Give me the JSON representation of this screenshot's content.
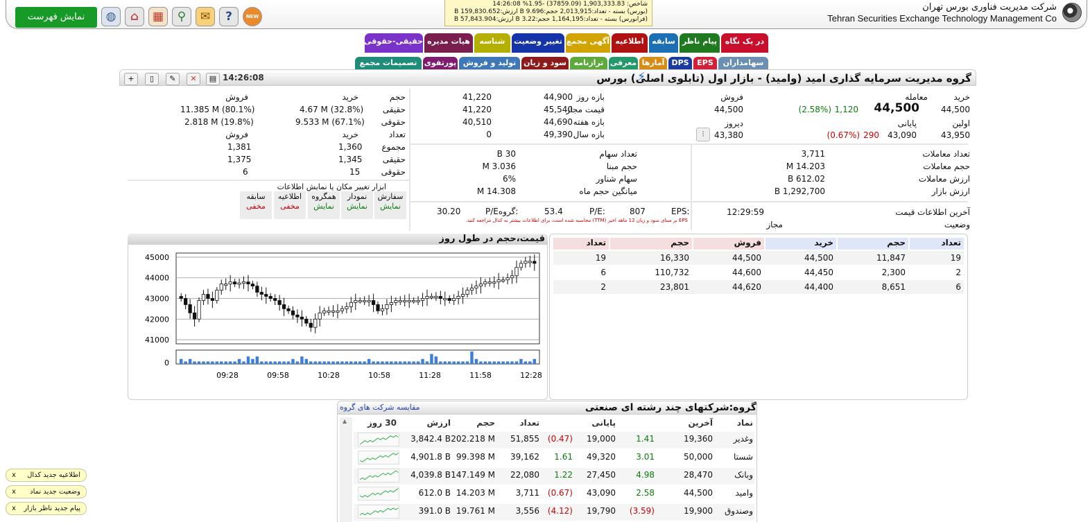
{
  "header": {
    "company_fa": "شرکت مدیریت فناوری بورس تهران",
    "company_en": "Tehran Securities Exchange Technology Management  Co",
    "show_list_label": "نمایش فهرست",
    "new_badge": "NEW",
    "index_lines": [
      "شاخص: 1,903,333.83 (37859.09) -1.95% 14:26:08",
      "(بورس) بسته - تعداد:2,013,915 حجم:9.696 B ارزش:159,830.652 B",
      "(فرابورس) بسته - تعداد:1,164,195 حجم:3.22 B ارزش:57,843.904 B"
    ]
  },
  "tabs_row1": [
    {
      "label": "در یک نگاه",
      "color": "#c8102e"
    },
    {
      "label": "پیام ناظر",
      "color": "#1f7a1f"
    },
    {
      "label": "سابقه",
      "color": "#1c6fb5"
    },
    {
      "label": "اطلاعیه",
      "color": "#b01212"
    },
    {
      "label": "آگهی مجمع",
      "color": "#d1a400"
    },
    {
      "label": "تغییر وضعیت",
      "color": "#1534a8"
    },
    {
      "label": "شناسه",
      "color": "#b5b000"
    },
    {
      "label": "هیات مدیره",
      "color": "#7a1e4e"
    },
    {
      "label": "حقیقی-حقوقی",
      "color": "#7a32c8"
    }
  ],
  "tabs_row2": [
    {
      "label": "سهامداران",
      "color": "#6a8fb0"
    },
    {
      "label": "EPS",
      "color": "#d0203a"
    },
    {
      "label": "DPS",
      "color": "#1a3aa0"
    },
    {
      "label": "آمارها",
      "color": "#d68c16"
    },
    {
      "label": "معرفی",
      "color": "#23986a"
    },
    {
      "label": "ترازنامه",
      "color": "#5ea83c"
    },
    {
      "label": "سود و زیان",
      "color": "#8c1a1a"
    },
    {
      "label": "تولید و فروش",
      "color": "#3f78b6"
    },
    {
      "label": "پورتفوی",
      "color": "#7e1c6e"
    },
    {
      "label": "تصمیمات مجمع",
      "color": "#1f8c7a"
    }
  ],
  "title": {
    "name": "گروه مدیریت سرمایه گذاری امید (وامید) - بازار اول (تابلوی اصلی) بورس",
    "time": "14:26:08"
  },
  "price": {
    "l_buy": "خرید",
    "buy": "44,500",
    "l_trade": "معامله",
    "trade": "44,500",
    "trade_chg": "1,120",
    "trade_pct": "(2.58%)",
    "l_sell": "فروش",
    "sell": "44,500",
    "l_first": "اولین",
    "first": "43,950",
    "l_final": "پایانی",
    "final": "43,090",
    "final_chg": "290",
    "final_pct": "(0.67%)",
    "l_yest": "دیروز",
    "yest": "43,380",
    "l_dayrange": "بازه روز",
    "dayrange_hi": "44,900",
    "dayrange_lo": "41,220",
    "l_allowed": "قیمت مجاز",
    "allowed_hi": "45,540",
    "allowed_lo": "41,220",
    "l_week": "بازه هفته",
    "week_hi": "44,690",
    "week_lo": "40,510",
    "l_year": "بازه سال",
    "year_hi": "49,390",
    "year_lo": "0"
  },
  "stats": {
    "l_count": "تعداد معاملات",
    "count": "3,711",
    "l_vol": "حجم معاملات",
    "vol": "14.203 M",
    "l_val": "ارزش معاملات",
    "val": "612.02 B",
    "l_mkt": "ارزش بازار",
    "mkt": "1,292,700 B",
    "l_shares": "تعداد سهام",
    "shares": "30 B",
    "l_base": "حجم مبنا",
    "base": "3.036 M",
    "l_float": "سهام شناور",
    "float": "6%",
    "l_avgmon": "میانگین حجم ماه",
    "avgmon": "14.308 M",
    "l_lastinfo": "آخرین اطلاعات قیمت",
    "lastinfo": "12:29:59",
    "l_status": "وضعیت",
    "status": "مجاز",
    "l_eps": "EPS:",
    "eps": "807",
    "l_pe": "P/E:",
    "pe": "53.4",
    "l_gpe": "P/Eگروه:",
    "gpe": "30.20",
    "eps_note": "EPS بر مبنای سود و زیان 12 ماهه اخیر (TTM) محاسبه شده است، برای اطلاعات بیشتر به کدال مراجعه کنید."
  },
  "individual": {
    "h_vol": "حجم",
    "h_buy": "خرید",
    "h_sell": "فروش",
    "l_ind": "حقیقی",
    "l_inst": "حقوقی",
    "vol_ind_buy": "4.67 M (32.8%)",
    "vol_ind_sell": "11.385 M (80.1%)",
    "vol_inst_buy": "9.533 M (67.1%)",
    "vol_inst_sell": "2.818 M (19.8%)",
    "h_cnt": "تعداد",
    "l_total": "مجموع",
    "cnt_total_buy": "1,360",
    "cnt_total_sell": "1,381",
    "cnt_ind_buy": "1,345",
    "cnt_ind_sell": "1,375",
    "cnt_inst_buy": "15",
    "cnt_inst_sell": "6"
  },
  "tools": {
    "caption": "ابزار تغییر مکان یا نمایش اطلاعات",
    "items": [
      {
        "label": "سفارش",
        "state": "نمایش",
        "color": "#0a7d0a"
      },
      {
        "label": "نمودار",
        "state": "نمایش",
        "color": "#0a7d0a"
      },
      {
        "label": "همگروه",
        "state": "نمایش",
        "color": "#0a7d0a"
      },
      {
        "label": "اطلاعیه",
        "state": "مخفی",
        "color": "#cc0000"
      },
      {
        "label": "سابقه",
        "state": "مخفی",
        "color": "#cc0000"
      }
    ]
  },
  "orders": {
    "headers": [
      "تعداد",
      "حجم",
      "خرید",
      "فروش",
      "حجم",
      "تعداد"
    ],
    "rows": [
      [
        "19",
        "11,847",
        "44,500",
        "44,500",
        "16,330",
        "19"
      ],
      [
        "2",
        "2,300",
        "44,450",
        "44,600",
        "110,732",
        "6"
      ],
      [
        "6",
        "8,651",
        "44,400",
        "44,620",
        "23,801",
        "2"
      ]
    ]
  },
  "chart_data": {
    "type": "candlestick",
    "title": "قیمت،حجم در طول روز",
    "ylim": [
      40800,
      45200
    ],
    "yticks": [
      "45000",
      "44000",
      "43000",
      "42000",
      "41000"
    ],
    "xticks": [
      "09:28",
      "09:58",
      "10:28",
      "10:58",
      "11:28",
      "11:58",
      "12:28"
    ],
    "vol_tick": "0",
    "closes": [
      43000,
      42700,
      42300,
      42000,
      42900,
      43200,
      43000,
      42900,
      43400,
      43700,
      43700,
      43800,
      43700,
      43750,
      43800,
      43700,
      43600,
      43300,
      43200,
      43100,
      43000,
      42900,
      42700,
      42500,
      42400,
      42200,
      42100,
      42000,
      41800,
      41600,
      42000,
      42300,
      42400,
      42400,
      42400,
      42400,
      42500,
      42600,
      42800,
      42900,
      42900,
      42900,
      42900,
      42700,
      42400,
      42500,
      42700,
      42800,
      42900,
      42900,
      42900,
      42900,
      42900,
      42900,
      43000,
      43100,
      43100,
      43100,
      43000,
      43000,
      42900,
      43000,
      43100,
      43200,
      43400,
      43500,
      43600,
      43700,
      43800,
      43800,
      43800,
      43900,
      43900,
      44000,
      44100,
      44500,
      44700,
      44800,
      44800,
      44700
    ],
    "volumes": [
      2,
      1,
      2,
      1,
      1,
      1,
      1,
      1,
      1,
      1,
      1,
      1,
      1,
      2,
      1,
      3,
      2,
      3,
      1,
      1,
      1,
      1,
      1,
      1,
      1,
      2,
      1,
      3,
      2,
      1,
      1,
      1,
      1,
      1,
      1,
      1,
      1,
      1,
      1,
      1,
      1,
      1,
      2,
      1,
      1,
      1,
      1,
      1,
      1,
      1,
      1,
      1,
      1,
      1,
      2,
      1,
      4,
      3,
      1,
      1,
      1,
      1,
      1,
      1,
      1,
      5,
      2,
      1,
      1,
      1,
      1,
      1,
      1,
      1,
      1,
      1,
      2,
      1,
      1,
      2
    ]
  },
  "group": {
    "title": "گروه:شرکتهای چند رشته ای صنعتی",
    "compare_link": "مقایسه شرکت های گروه",
    "headers": [
      "نماد",
      "آخرین",
      "",
      "پایانی",
      "",
      "تعداد",
      "حجم",
      "ارزش",
      "30 روز"
    ],
    "rows": [
      {
        "sym": "وغدیر",
        "last": "19,360",
        "lastc": "1.41",
        "final": "19,000",
        "finalc": "(0.47)",
        "count": "51,855",
        "vol": "202.218 M",
        "val": "3,842.4 B",
        "lcolor": "#0a7d0a",
        "fcolor": "#cc0000"
      },
      {
        "sym": "شستا",
        "last": "50,000",
        "lastc": "3.01",
        "final": "49,320",
        "finalc": "1.61",
        "count": "39,162",
        "vol": "99.398 M",
        "val": "4,901.8 B",
        "lcolor": "#0a7d0a",
        "fcolor": "#0a7d0a"
      },
      {
        "sym": "وبانک",
        "last": "28,470",
        "lastc": "4.98",
        "final": "27,450",
        "finalc": "1.22",
        "count": "22,080",
        "vol": "147.149 M",
        "val": "4,039.8 B",
        "lcolor": "#0a7d0a",
        "fcolor": "#0a7d0a"
      },
      {
        "sym": "وامید",
        "last": "44,500",
        "lastc": "2.58",
        "final": "43,090",
        "finalc": "(0.67)",
        "count": "3,711",
        "vol": "14.203 M",
        "val": "612.0 B",
        "lcolor": "#0a7d0a",
        "fcolor": "#cc0000"
      },
      {
        "sym": "وصندوق",
        "last": "19,900",
        "lastc": "(3.59)",
        "final": "19,790",
        "finalc": "(4.12)",
        "count": "3,556",
        "vol": "19.761 M",
        "val": "391.0 B",
        "lcolor": "#cc0000",
        "fcolor": "#cc0000"
      }
    ]
  },
  "notifications": [
    "اطلاعیه جدید کدال",
    "وضعیت جدید نماد",
    "پیام جدید ناظر بازار"
  ],
  "close_x": "x"
}
